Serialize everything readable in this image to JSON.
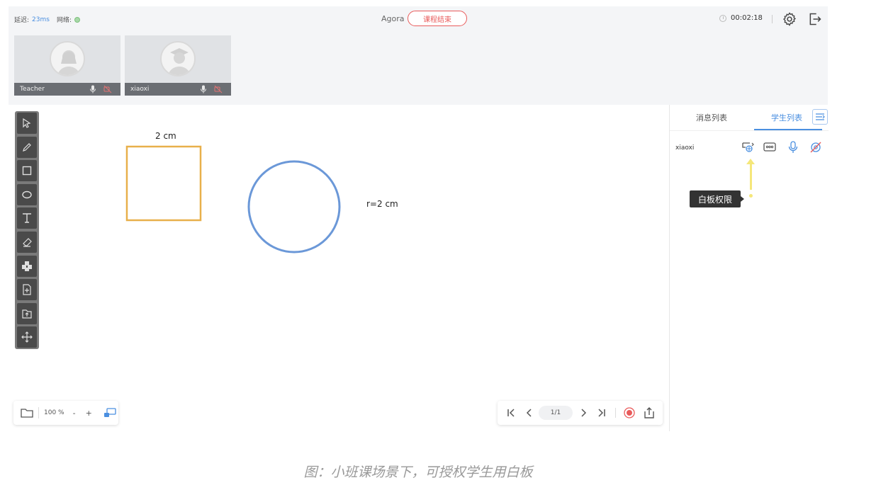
{
  "header": {
    "latency_label": "延迟:",
    "latency_value": "23ms",
    "network_label": "网络:",
    "room_name": "Agora",
    "end_button": "课程结束",
    "timer": "00:02:18"
  },
  "videos": [
    {
      "name": "Teacher"
    },
    {
      "name": "xiaoxi"
    }
  ],
  "whiteboard": {
    "square_label": "2 cm",
    "circle_label": "r=2 cm",
    "zoom": "100 %",
    "zoom_minus": "-",
    "zoom_plus": "+",
    "page_indicator": "1/1"
  },
  "panel": {
    "tab_messages": "消息列表",
    "tab_students": "学生列表",
    "student_name": "xiaoxi",
    "tooltip": "白板权限"
  },
  "caption": "图：小班课场景下，可授权学生用白板",
  "colors": {
    "accent": "#4a8fe0",
    "end_red": "#e95b5b",
    "square_stroke": "#e8b04b",
    "circle_stroke": "#6b98d8",
    "arrow": "#f5e77a"
  }
}
